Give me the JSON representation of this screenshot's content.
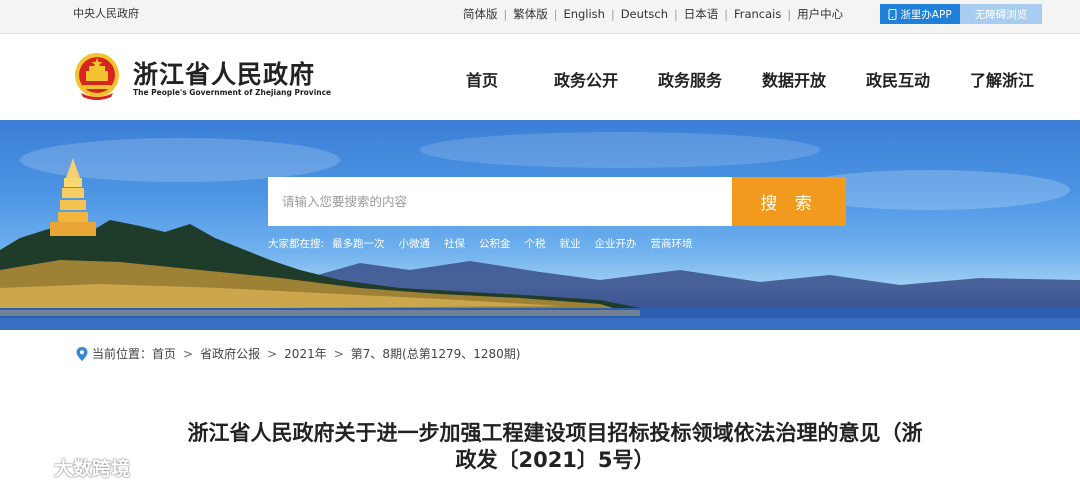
{
  "topbar": {
    "central_link": "中央人民政府",
    "languages": [
      "简体版",
      "繁体版",
      "English",
      "Deutsch",
      "日本语",
      "Francais",
      "用户中心"
    ],
    "app_button": "浙里办APP",
    "accessibility_button": "无障碍浏览"
  },
  "header": {
    "title": "浙江省人民政府",
    "subtitle": "The People's Government of Zhejiang Province",
    "nav": [
      "首页",
      "政务公开",
      "政务服务",
      "数据开放",
      "政民互动",
      "了解浙江"
    ]
  },
  "banner": {
    "search_placeholder": "请输入您要搜索的内容",
    "search_button": "搜 索",
    "hot_label": "大家都在搜:",
    "hot_items": [
      "最多跑一次",
      "小微通",
      "社保",
      "公积金",
      "个税",
      "就业",
      "企业开办",
      "营商环境"
    ]
  },
  "breadcrumb": {
    "label": "当前位置：",
    "items": [
      "首页",
      "省政府公报",
      "2021年",
      "第7、8期(总第1279、1280期)"
    ]
  },
  "article": {
    "title_line1": "浙江省人民政府关于进一步加强工程建设项目招标投标领域依法治理的意见（浙",
    "title_line2": "政发〔2021〕5号）"
  },
  "watermark": {
    "text": "大数跨境"
  },
  "colors": {
    "accent_blue": "#1e80d8",
    "search_orange": "#f29a1e",
    "emblem_red": "#d8251c",
    "emblem_gold": "#f2c230"
  }
}
